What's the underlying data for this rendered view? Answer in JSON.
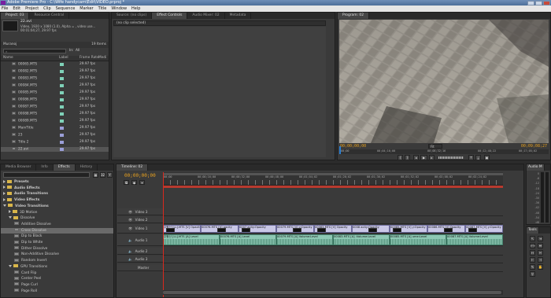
{
  "window": {
    "title": "Adobe Premiere Pro - C:\\Wife handycam\\Edit\\VIDEO.prproj *"
  },
  "menu": [
    "File",
    "Edit",
    "Project",
    "Clip",
    "Sequence",
    "Marker",
    "Title",
    "Window",
    "Help"
  ],
  "project_panel": {
    "tabs": [
      "Project: 03",
      "Resource Central"
    ],
    "selected_clip": {
      "name": "22.avi",
      "line1": "Video, 1920 x 1080 (1.0), Alpha = , video use...",
      "line2": "00:01:04;27, 29.97 fps"
    },
    "bin_name": "Muranoj",
    "item_count": "19 Items",
    "search_in_label": "In:",
    "search_in_value": "All",
    "columns": [
      "Name",
      "Label",
      "Frame Rate",
      "Medi"
    ],
    "items": [
      {
        "name": "00065.MTS",
        "rate": "29.97 fps",
        "color": "#7fd1b8"
      },
      {
        "name": "00082.MTS",
        "rate": "29.97 fps",
        "color": "#7fd1b8"
      },
      {
        "name": "00083.MTS",
        "rate": "29.97 fps",
        "color": "#7fd1b8"
      },
      {
        "name": "00084.MTS",
        "rate": "29.97 fps",
        "color": "#7fd1b8"
      },
      {
        "name": "00085.MTS",
        "rate": "29.97 fps",
        "color": "#7fd1b8"
      },
      {
        "name": "00086.MTS",
        "rate": "29.97 fps",
        "color": "#7fd1b8"
      },
      {
        "name": "00087.MTS",
        "rate": "29.97 fps",
        "color": "#7fd1b8"
      },
      {
        "name": "00088.MTS",
        "rate": "29.97 fps",
        "color": "#7fd1b8"
      },
      {
        "name": "00089.MTS",
        "rate": "29.97 fps",
        "color": "#7fd1b8"
      },
      {
        "name": "MainTitle",
        "rate": "29.97 fps",
        "color": "#9b9fd8"
      },
      {
        "name": "23",
        "rate": "29.97 fps",
        "color": "#9b9fd8"
      },
      {
        "name": "Title 2",
        "rate": "29.97 fps",
        "color": "#9b9fd8"
      },
      {
        "name": "22.avi",
        "rate": "29.97 fps",
        "color": "#9b9fd8"
      }
    ]
  },
  "source_panel": {
    "tabs": [
      "Source: (no clips)",
      "Effect Controls",
      "Audio Mixer: 02",
      "Metadata"
    ],
    "no_clip_text": "(no clip selected)"
  },
  "program_panel": {
    "tabs": [
      "Program: 02"
    ],
    "timecode_left": "00;00;00;00",
    "timecode_right": "00;09;08;27",
    "ruler": [
      "00;00",
      "00;04;16;00",
      "00;08;32;16",
      "00;12;48;22",
      "00;17;05;02"
    ],
    "zoom": "Fit"
  },
  "effects_panel": {
    "tabs": [
      "Media Browser",
      "Info",
      "Effects",
      "History"
    ],
    "items": [
      {
        "label": "Presets",
        "kind": "folder",
        "level": 0,
        "open": false
      },
      {
        "label": "Audio Effects",
        "kind": "folder",
        "level": 0,
        "open": false
      },
      {
        "label": "Audio Transitions",
        "kind": "folder",
        "level": 0,
        "open": false
      },
      {
        "label": "Video Effects",
        "kind": "folder",
        "level": 0,
        "open": false
      },
      {
        "label": "Video Transitions",
        "kind": "folder",
        "level": 0,
        "open": true
      },
      {
        "label": "3D Motion",
        "kind": "folder",
        "level": 1,
        "open": false
      },
      {
        "label": "Dissolve",
        "kind": "folder",
        "level": 1,
        "open": true
      },
      {
        "label": "Additive Dissolve",
        "kind": "fx",
        "level": 2
      },
      {
        "label": "Cross Dissolve",
        "kind": "fx",
        "level": 2,
        "selected": true
      },
      {
        "label": "Dip to Black",
        "kind": "fx",
        "level": 2
      },
      {
        "label": "Dip to White",
        "kind": "fx",
        "level": 2
      },
      {
        "label": "Dither Dissolve",
        "kind": "fx",
        "level": 2
      },
      {
        "label": "Non-Additive Dissolve",
        "kind": "fx",
        "level": 2
      },
      {
        "label": "Random Invert",
        "kind": "fx",
        "level": 2
      },
      {
        "label": "GPU Transitions",
        "kind": "folder",
        "level": 1,
        "open": true
      },
      {
        "label": "Card Flip",
        "kind": "fx",
        "level": 2
      },
      {
        "label": "Center Peel",
        "kind": "fx",
        "level": 2
      },
      {
        "label": "Page Curl",
        "kind": "fx",
        "level": 2
      },
      {
        "label": "Page Roll",
        "kind": "fx",
        "level": 2
      }
    ]
  },
  "timeline": {
    "tabs": [
      "Timeline: 02"
    ],
    "timecode": "00;00;00;00",
    "ruler": [
      "00;00",
      "00;00;16;00",
      "00;00;32;00",
      "00;00;48;00",
      "00;01;04;02",
      "00;01;20;02",
      "00;01;36;02",
      "00;01;52;02",
      "00;02;08;02",
      "00;02;24;02"
    ],
    "tracks": {
      "video3": "Video 3",
      "video2": "Video 2",
      "video1": "Video 1",
      "audio1": "Audio 1",
      "audio2": "Audio 2",
      "audio3": "Audio 3",
      "master": "Master"
    },
    "video_clips": [
      "주왕산 [LL].MTS [V] Opacity",
      "00076.MTS [V] pacity",
      "0007 acity:Opacity",
      "00079.MTS [V] y:Opacity",
      "00083.MTS [V] Opacity",
      "0008 acity:Opacity",
      "00085.MTS [V] y:Opacity",
      "00086.MTS [V] Opacity",
      "00087.MTS [V] y:Opacity"
    ],
    "audio_clips": [
      "주왕산 [LL].MTS [A] Level",
      "00076.MTS [A] Level",
      "00079.MTS [A] Volume:Level",
      "00083.MTS [A] :Volume:Level",
      "00085.MTS [A] ume:Level",
      "00087.MTS [A] Volume:Level"
    ]
  },
  "audio_meters": {
    "tabs": [
      "Audio M"
    ],
    "scale": [
      "0",
      "-6",
      "-12",
      "-18",
      "-24",
      "-30",
      "-36",
      "-42",
      "-48",
      "-54",
      "dB"
    ]
  },
  "tools": {
    "tabs": [
      "Tools"
    ]
  },
  "colors": {
    "timecode": "#e9a21f",
    "playhead": "#d9291e",
    "video_clip": "#c9c7e6",
    "audio_clip": "#8ec8b4"
  }
}
